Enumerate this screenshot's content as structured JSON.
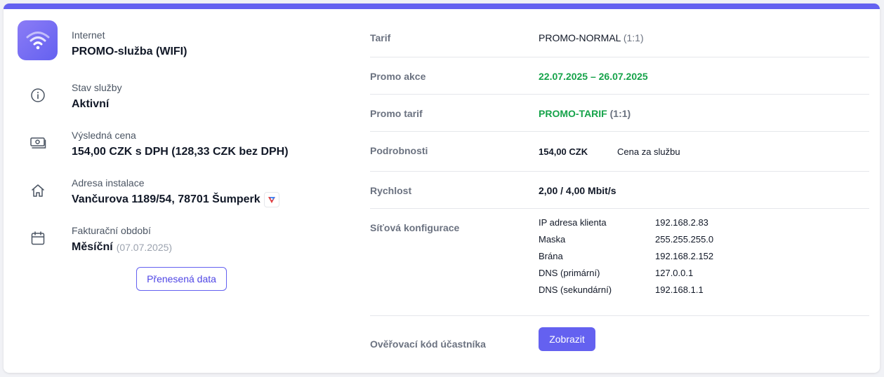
{
  "colors": {
    "accent": "#6461f0",
    "success": "#16a34a",
    "label_gray": "#6b7280"
  },
  "service": {
    "type_label": "Internet",
    "name": "PROMO-služba (WIFI)",
    "icon": "wifi-icon"
  },
  "status": {
    "label": "Stav služby",
    "value": "Aktivní",
    "icon": "info-icon"
  },
  "price": {
    "label": "Výsledná cena",
    "value": "154,00 CZK s DPH (128,33 CZK bez DPH)",
    "icon": "money-icon"
  },
  "address": {
    "label": "Adresa instalace",
    "value": "Vančurova 1189/54, 78701 Šumperk",
    "icon": "home-icon",
    "map_icon": "map-icon"
  },
  "billing": {
    "label": "Fakturační období",
    "value": "Měsíční",
    "date": "(07.07.2025)",
    "icon": "calendar-icon"
  },
  "transferred_button": "Přenesená data",
  "details": {
    "tarif": {
      "label": "Tarif",
      "value": "PROMO-NORMAL",
      "ratio": "(1:1)"
    },
    "promo_akce": {
      "label": "Promo akce",
      "value": "22.07.2025 – 26.07.2025"
    },
    "promo_tarif": {
      "label": "Promo tarif",
      "value": "PROMO-TARIF",
      "ratio": "(1:1)"
    },
    "podrobnosti": {
      "label": "Podrobnosti",
      "price": "154,00 CZK",
      "desc": "Cena za službu"
    },
    "rychlost": {
      "label": "Rychlost",
      "value": "2,00 / 4,00 Mbit/s"
    },
    "network": {
      "label": "Síťová konfigurace",
      "rows": [
        {
          "key": "IP adresa klienta",
          "value": "192.168.2.83"
        },
        {
          "key": "Maska",
          "value": "255.255.255.0"
        },
        {
          "key": "Brána",
          "value": "192.168.2.152"
        },
        {
          "key": "DNS (primární)",
          "value": "127.0.0.1"
        },
        {
          "key": "DNS (sekundární)",
          "value": "192.168.1.1"
        }
      ]
    },
    "verify": {
      "label": "Ověřovací kód účastníka",
      "button": "Zobrazit"
    }
  }
}
